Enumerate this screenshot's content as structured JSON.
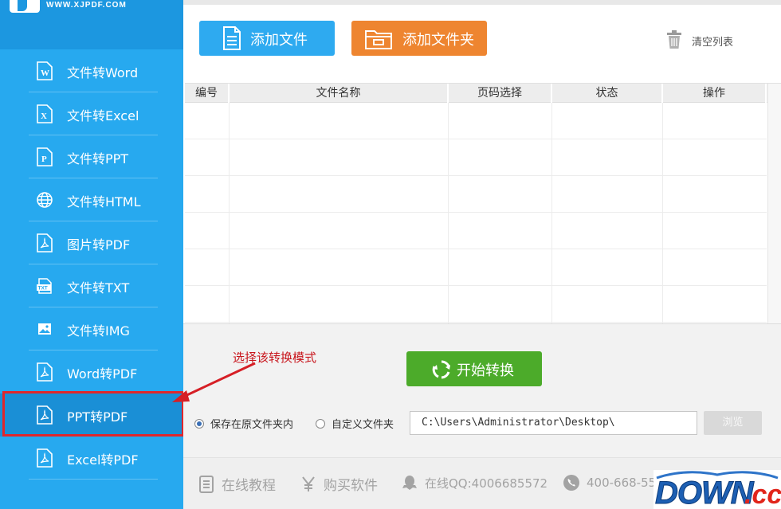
{
  "header": {
    "logo_url": "WWW.XJPDF.COM"
  },
  "sidebar": {
    "items": [
      {
        "label": "文件转Word",
        "icon": "word-file-icon"
      },
      {
        "label": "文件转Excel",
        "icon": "excel-file-icon"
      },
      {
        "label": "文件转PPT",
        "icon": "ppt-file-icon"
      },
      {
        "label": "文件转HTML",
        "icon": "globe-icon"
      },
      {
        "label": "图片转PDF",
        "icon": "pdf-file-icon"
      },
      {
        "label": "文件转TXT",
        "icon": "txt-file-icon"
      },
      {
        "label": "文件转IMG",
        "icon": "image-icon"
      },
      {
        "label": "Word转PDF",
        "icon": "pdf-file-icon"
      },
      {
        "label": "PPT转PDF",
        "icon": "pdf-file-icon",
        "active": true
      },
      {
        "label": "Excel转PDF",
        "icon": "pdf-file-icon"
      }
    ]
  },
  "toolbar": {
    "add_file_label": "添加文件",
    "add_folder_label": "添加文件夹",
    "clear_list_label": "清空列表"
  },
  "table": {
    "columns": [
      "编号",
      "文件名称",
      "页码选择",
      "状态",
      "操作"
    ],
    "rows": []
  },
  "annotation": {
    "text": "选择该转换模式"
  },
  "actions": {
    "start_label": "开始转换"
  },
  "output": {
    "option_keep": "保存在原文件夹内",
    "option_custom": "自定义文件夹",
    "selected": "keep",
    "path_value": "C:\\Users\\Administrator\\Desktop\\",
    "browse_label": "浏览"
  },
  "footer": {
    "tutorial_label": "在线教程",
    "buy_label": "购买软件",
    "qq_label": "在线QQ:4006685572",
    "phone_label": "400-668-55"
  },
  "watermark": {
    "text": "DOWN.cc"
  },
  "colors": {
    "sidebar": "#27a9ef",
    "add_file": "#2eaaf0",
    "add_folder": "#ee8530",
    "start": "#4cab2a",
    "annotation": "#c8161d"
  }
}
